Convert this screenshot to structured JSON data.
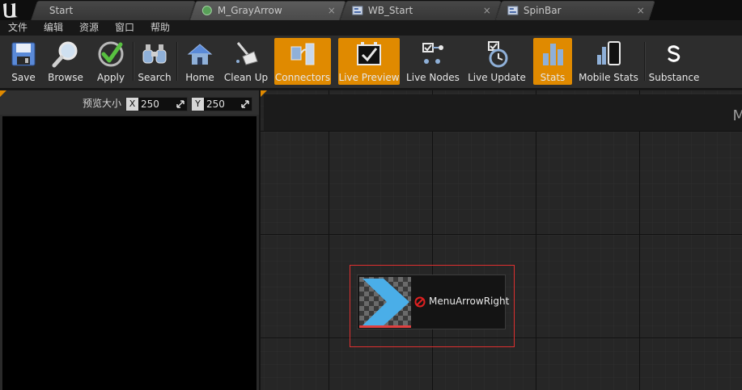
{
  "tabs": [
    {
      "label": "Start",
      "icon": "none",
      "active": false
    },
    {
      "label": "M_GrayArrow",
      "icon": "material-icon",
      "active": true,
      "close": "×"
    },
    {
      "label": "WB_Start",
      "icon": "widget-blueprint-icon",
      "active": false,
      "close": "×"
    },
    {
      "label": "SpinBar",
      "icon": "widget-blueprint-icon",
      "active": false,
      "close": "×"
    }
  ],
  "menu": [
    "文件",
    "编辑",
    "资源",
    "窗口",
    "帮助"
  ],
  "toolbar": [
    {
      "label": "Save",
      "icon": "save-icon",
      "active": false
    },
    {
      "label": "Browse",
      "icon": "browse-icon",
      "active": false
    },
    {
      "label": "Apply",
      "icon": "apply-icon",
      "active": false
    },
    {
      "label": "Search",
      "icon": "search-icon",
      "active": false
    },
    {
      "label": "Home",
      "icon": "home-icon",
      "active": false
    },
    {
      "label": "Clean Up",
      "icon": "clean-up-icon",
      "active": false
    },
    {
      "label": "Connectors",
      "icon": "connectors-icon",
      "active": true
    },
    {
      "label": "Live Preview",
      "icon": "live-preview-icon",
      "active": true
    },
    {
      "label": "Live Nodes",
      "icon": "live-nodes-icon",
      "active": false
    },
    {
      "label": "Live Update",
      "icon": "live-update-icon",
      "active": false
    },
    {
      "label": "Stats",
      "icon": "stats-icon",
      "active": true
    },
    {
      "label": "Mobile Stats",
      "icon": "mobile-stats-icon",
      "active": false
    },
    {
      "label": "Substance",
      "icon": "substance-icon",
      "active": false
    }
  ],
  "preview": {
    "size_label": "预览大小",
    "x_axis": "X",
    "x_value": "250",
    "y_axis": "Y",
    "y_value": "250"
  },
  "graph": {
    "title_partial": "M",
    "node": {
      "label": "MenuArrowRight",
      "error_icon": "error-icon",
      "thumbnail_color": "#4aaee8"
    }
  },
  "colors": {
    "accent": "#e08a00",
    "selection": "#e03030"
  }
}
